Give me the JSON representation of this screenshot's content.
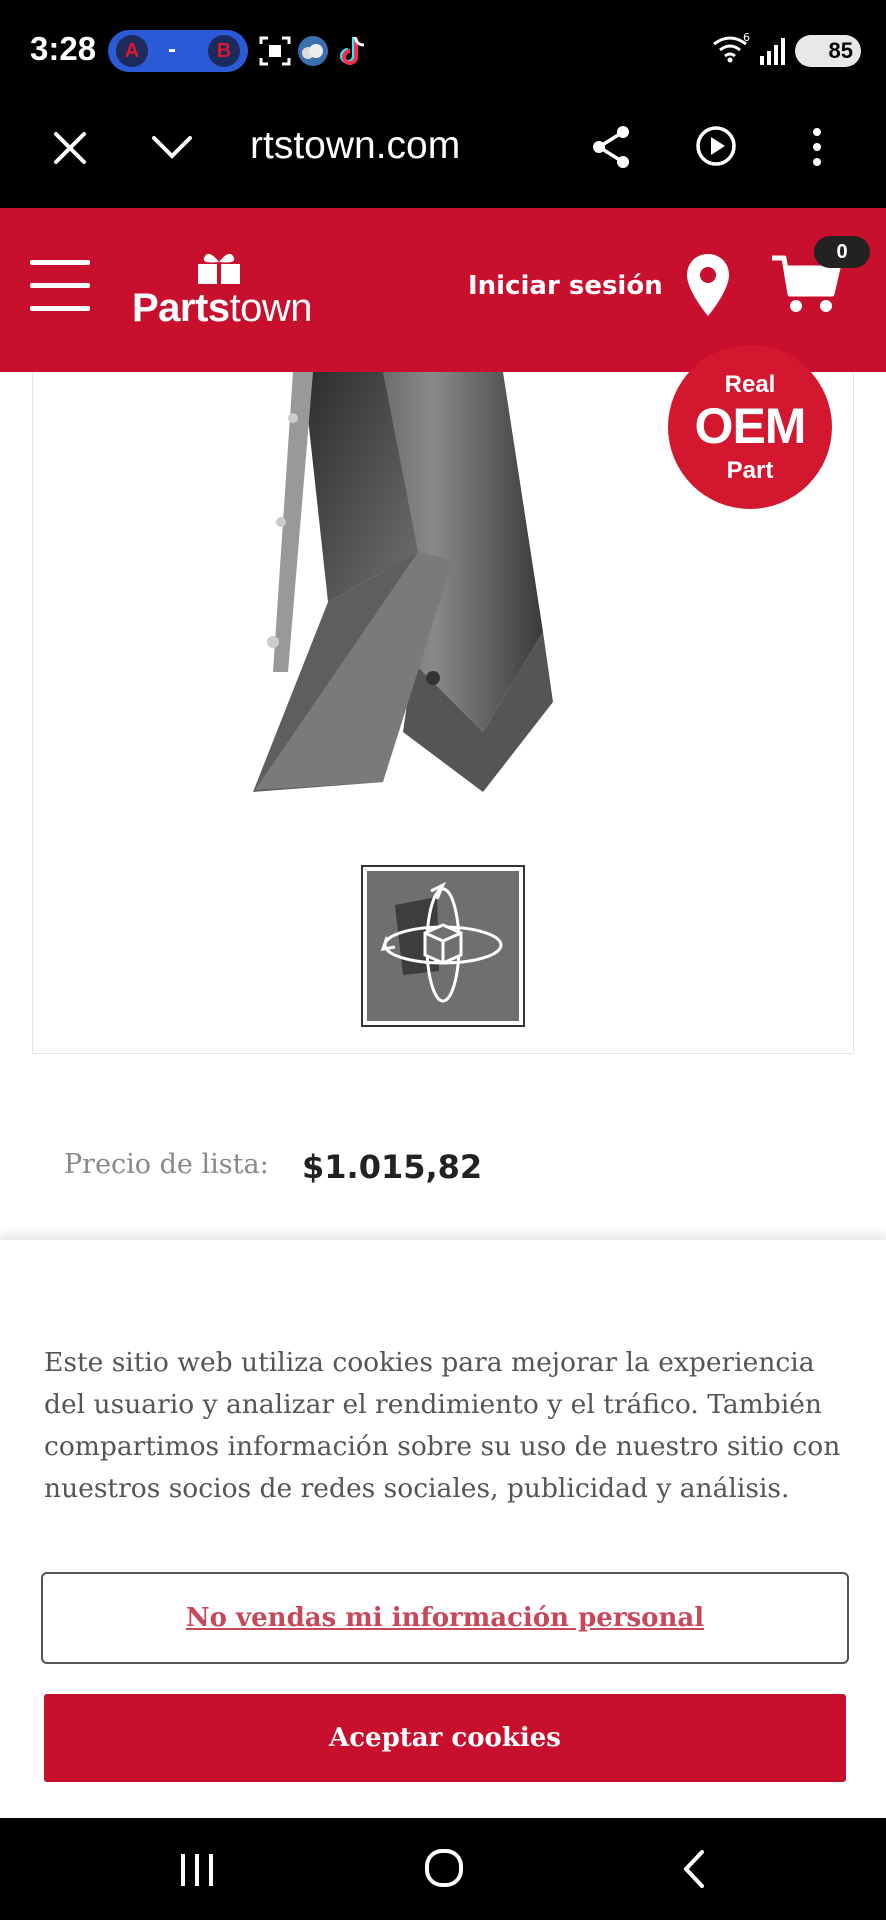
{
  "status": {
    "time": "3:28",
    "score": {
      "team_a": "A",
      "separator": "-",
      "team_b": "B"
    },
    "battery": "85"
  },
  "browser": {
    "url": "rtstown.com"
  },
  "header": {
    "logo_bold": "Parts",
    "logo_light": "town",
    "signin": "Iniciar sesión",
    "cart_count": "0"
  },
  "product": {
    "badge_top": "Real",
    "badge_main": "OEM",
    "badge_bottom": "Part",
    "price_label": "Precio de lista:",
    "price": "$1.015,82"
  },
  "cookie": {
    "message": "Este sitio web utiliza cookies para mejorar la experiencia del usuario y analizar el rendimiento y el tráfico. También compartimos información sobre su uso de nuestro sitio con nuestros socios de redes sociales, publicidad y análisis.",
    "opt_out": "No vendas mi información personal",
    "accept": "Aceptar cookies"
  },
  "colors": {
    "brand_red": "#c8102e",
    "toolbar_black": "#000000",
    "opt_out_text": "#c8475b"
  }
}
